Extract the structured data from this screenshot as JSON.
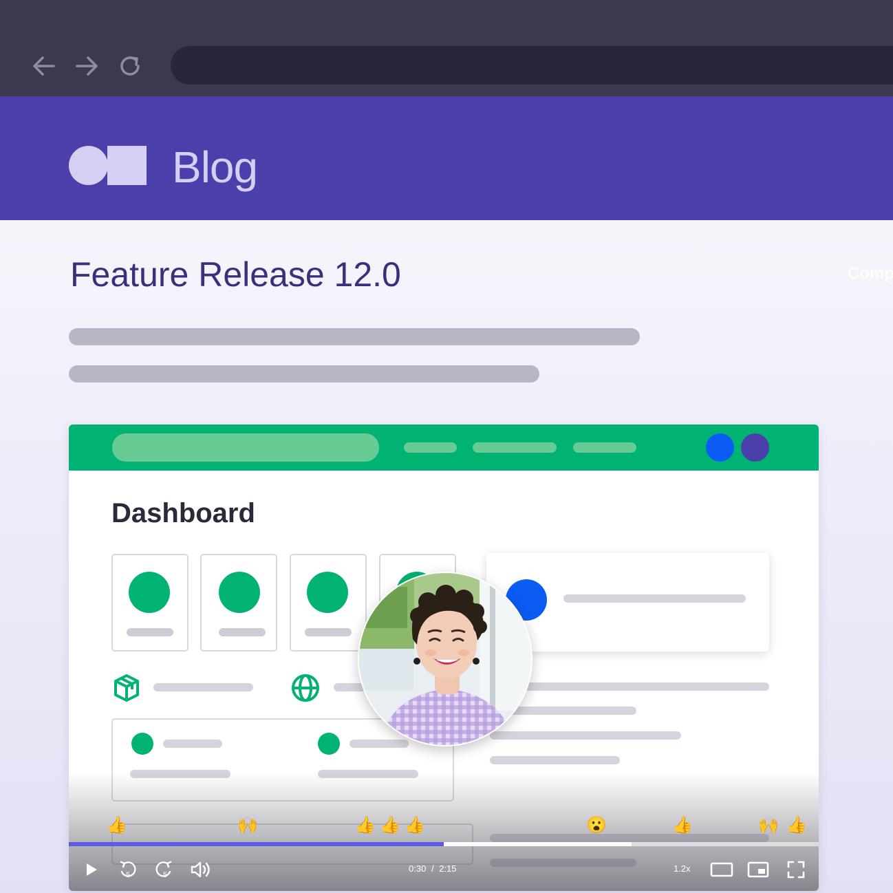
{
  "browser": {
    "back_icon": "arrow-left-icon",
    "forward_icon": "arrow-right-icon",
    "reload_icon": "reload-icon",
    "url": ""
  },
  "blog": {
    "title": "Blog",
    "brand_color": "#4b40ab"
  },
  "article": {
    "title": "Feature Release 12.0",
    "overflow_text": "Comp"
  },
  "app": {
    "accent": "#00b373",
    "dashboard_title": "Dashboard",
    "tile_icons": [
      "box-icon",
      "globe-icon"
    ]
  },
  "video": {
    "current_time": "0:30",
    "separator": "/",
    "duration": "2:15",
    "speed": "1.2x",
    "progress": 0.5,
    "buffered": 0.75,
    "reactions": [
      "👍",
      "🙌",
      "👍",
      "👍",
      "👍",
      "😮",
      "👍",
      "🙌",
      "👍"
    ]
  }
}
